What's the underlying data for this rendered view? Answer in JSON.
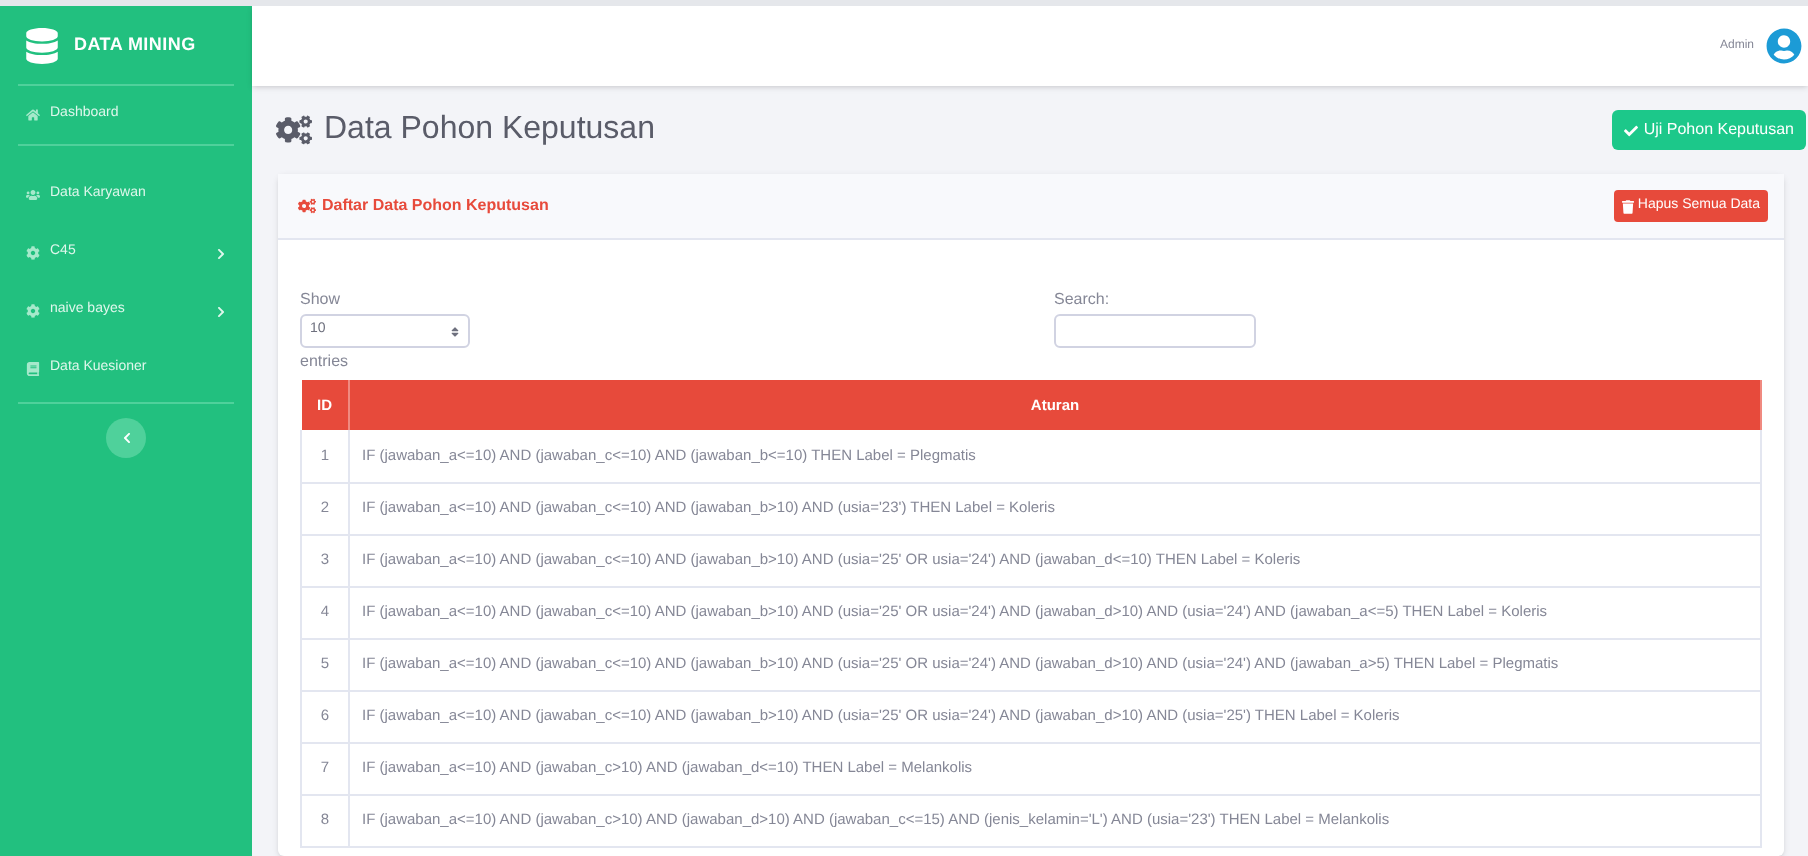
{
  "brand": {
    "title": "DATA MINING"
  },
  "sidebar": {
    "items": [
      {
        "label": "Dashboard",
        "kind": "link"
      },
      {
        "label": "Data Karyawan",
        "kind": "link"
      },
      {
        "label": "C45",
        "kind": "menu"
      },
      {
        "label": "naive bayes",
        "kind": "menu"
      },
      {
        "label": "Data Kuesioner",
        "kind": "link"
      }
    ]
  },
  "topbar": {
    "user": "Admin"
  },
  "page": {
    "title": "Data Pohon Keputusan",
    "action": "Uji Pohon Keputusan"
  },
  "card": {
    "title": "Daftar Data Pohon Keputusan",
    "action": "Hapus Semua Data",
    "length": {
      "label_before": "Show",
      "value": "10",
      "label_after": "entries"
    },
    "search": {
      "label": "Search:"
    },
    "table": {
      "columns": [
        "ID",
        "Aturan"
      ],
      "rows": [
        [
          "1",
          "IF (jawaban_a<=10) AND (jawaban_c<=10) AND (jawaban_b<=10) THEN Label = Plegmatis"
        ],
        [
          "2",
          "IF (jawaban_a<=10) AND (jawaban_c<=10) AND (jawaban_b>10) AND (usia='23') THEN Label = Koleris"
        ],
        [
          "3",
          "IF (jawaban_a<=10) AND (jawaban_c<=10) AND (jawaban_b>10) AND (usia='25' OR usia='24') AND (jawaban_d<=10) THEN Label = Koleris"
        ],
        [
          "4",
          "IF (jawaban_a<=10) AND (jawaban_c<=10) AND (jawaban_b>10) AND (usia='25' OR usia='24') AND (jawaban_d>10) AND (usia='24') AND (jawaban_a<=5) THEN Label = Koleris"
        ],
        [
          "5",
          "IF (jawaban_a<=10) AND (jawaban_c<=10) AND (jawaban_b>10) AND (usia='25' OR usia='24') AND (jawaban_d>10) AND (usia='24') AND (jawaban_a>5) THEN Label = Plegmatis"
        ],
        [
          "6",
          "IF (jawaban_a<=10) AND (jawaban_c<=10) AND (jawaban_b>10) AND (usia='25' OR usia='24') AND (jawaban_d>10) AND (usia='25') THEN Label = Koleris"
        ],
        [
          "7",
          "IF (jawaban_a<=10) AND (jawaban_c>10) AND (jawaban_d<=10) THEN Label = Melankolis"
        ],
        [
          "8",
          "IF (jawaban_a<=10) AND (jawaban_c>10) AND (jawaban_d>10) AND (jawaban_c<=15) AND (jenis_kelamin='L') AND (usia='23') THEN Label = Melankolis"
        ]
      ]
    }
  }
}
